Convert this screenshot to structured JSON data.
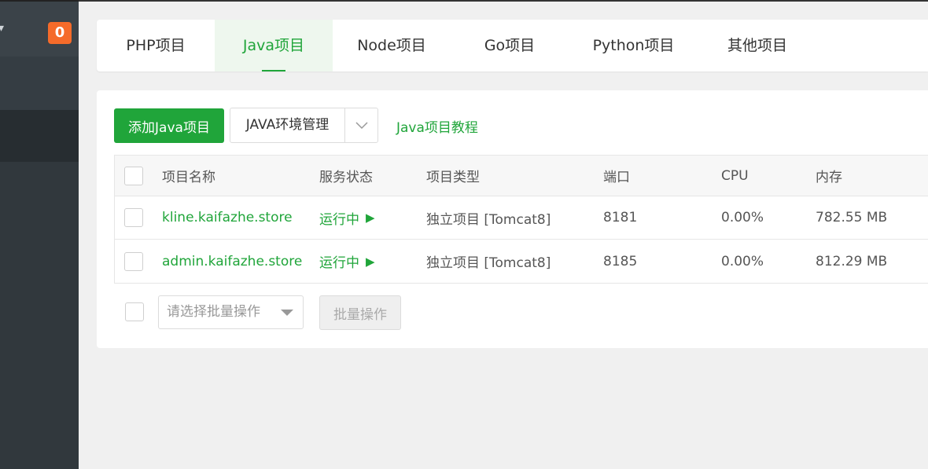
{
  "sidebar": {
    "badge_count": "0"
  },
  "tabs": [
    {
      "label": "PHP项目"
    },
    {
      "label": "Java项目"
    },
    {
      "label": "Node项目"
    },
    {
      "label": "Go项目"
    },
    {
      "label": "Python项目"
    },
    {
      "label": "其他项目"
    }
  ],
  "active_tab": "Java项目",
  "toolbar": {
    "add_label": "添加Java项目",
    "env_label": "JAVA环境管理",
    "tutorial_label": "Java项目教程"
  },
  "table": {
    "headers": {
      "name": "项目名称",
      "status": "服务状态",
      "type": "项目类型",
      "port": "端口",
      "cpu": "CPU",
      "mem": "内存"
    },
    "rows": [
      {
        "name": "kline.kaifazhe.store",
        "status": "运行中",
        "type": "独立项目 [Tomcat8]",
        "port": "8181",
        "cpu": "0.00%",
        "mem": "782.55 MB"
      },
      {
        "name": "admin.kaifazhe.store",
        "status": "运行中",
        "type": "独立项目 [Tomcat8]",
        "port": "8185",
        "cpu": "0.00%",
        "mem": "812.29 MB"
      }
    ]
  },
  "batch": {
    "placeholder": "请选择批量操作",
    "button_label": "批量操作"
  },
  "colors": {
    "accent": "#20a53a",
    "badge": "#f56b2a",
    "sidebar": "#31383d"
  }
}
